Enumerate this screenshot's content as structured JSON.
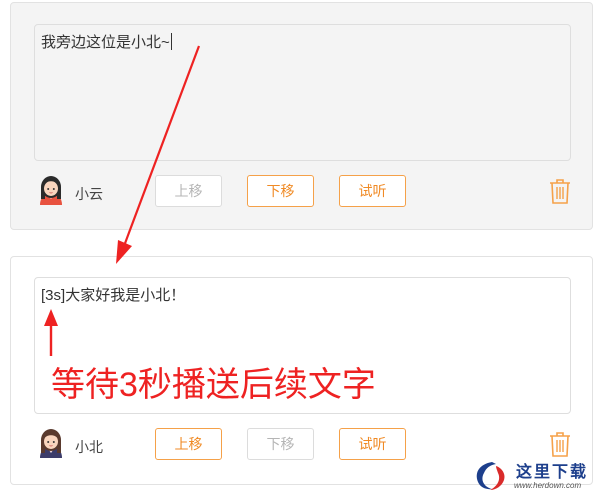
{
  "cards": [
    {
      "text": "我旁边这位是小北~",
      "speaker": "小云",
      "buttons": {
        "up": {
          "label": "上移",
          "enabled": false
        },
        "down": {
          "label": "下移",
          "enabled": true
        },
        "preview": {
          "label": "试听",
          "enabled": true
        }
      }
    },
    {
      "tag": "[3s]",
      "text": "大家好我是小北！",
      "speaker": "小北",
      "buttons": {
        "up": {
          "label": "上移",
          "enabled": true
        },
        "down": {
          "label": "下移",
          "enabled": false
        },
        "preview": {
          "label": "试听",
          "enabled": true
        }
      }
    }
  ],
  "annotation": "等待3秒播送后续文字",
  "watermark": {
    "text": "这里下载",
    "url": "www.herdown.com"
  },
  "colors": {
    "accent": "#f08a24",
    "annotation": "#ee2222",
    "disabled": "#b5b5b5"
  },
  "icons": [
    "girl-avatar-icon",
    "trash-icon",
    "logo-icon"
  ]
}
